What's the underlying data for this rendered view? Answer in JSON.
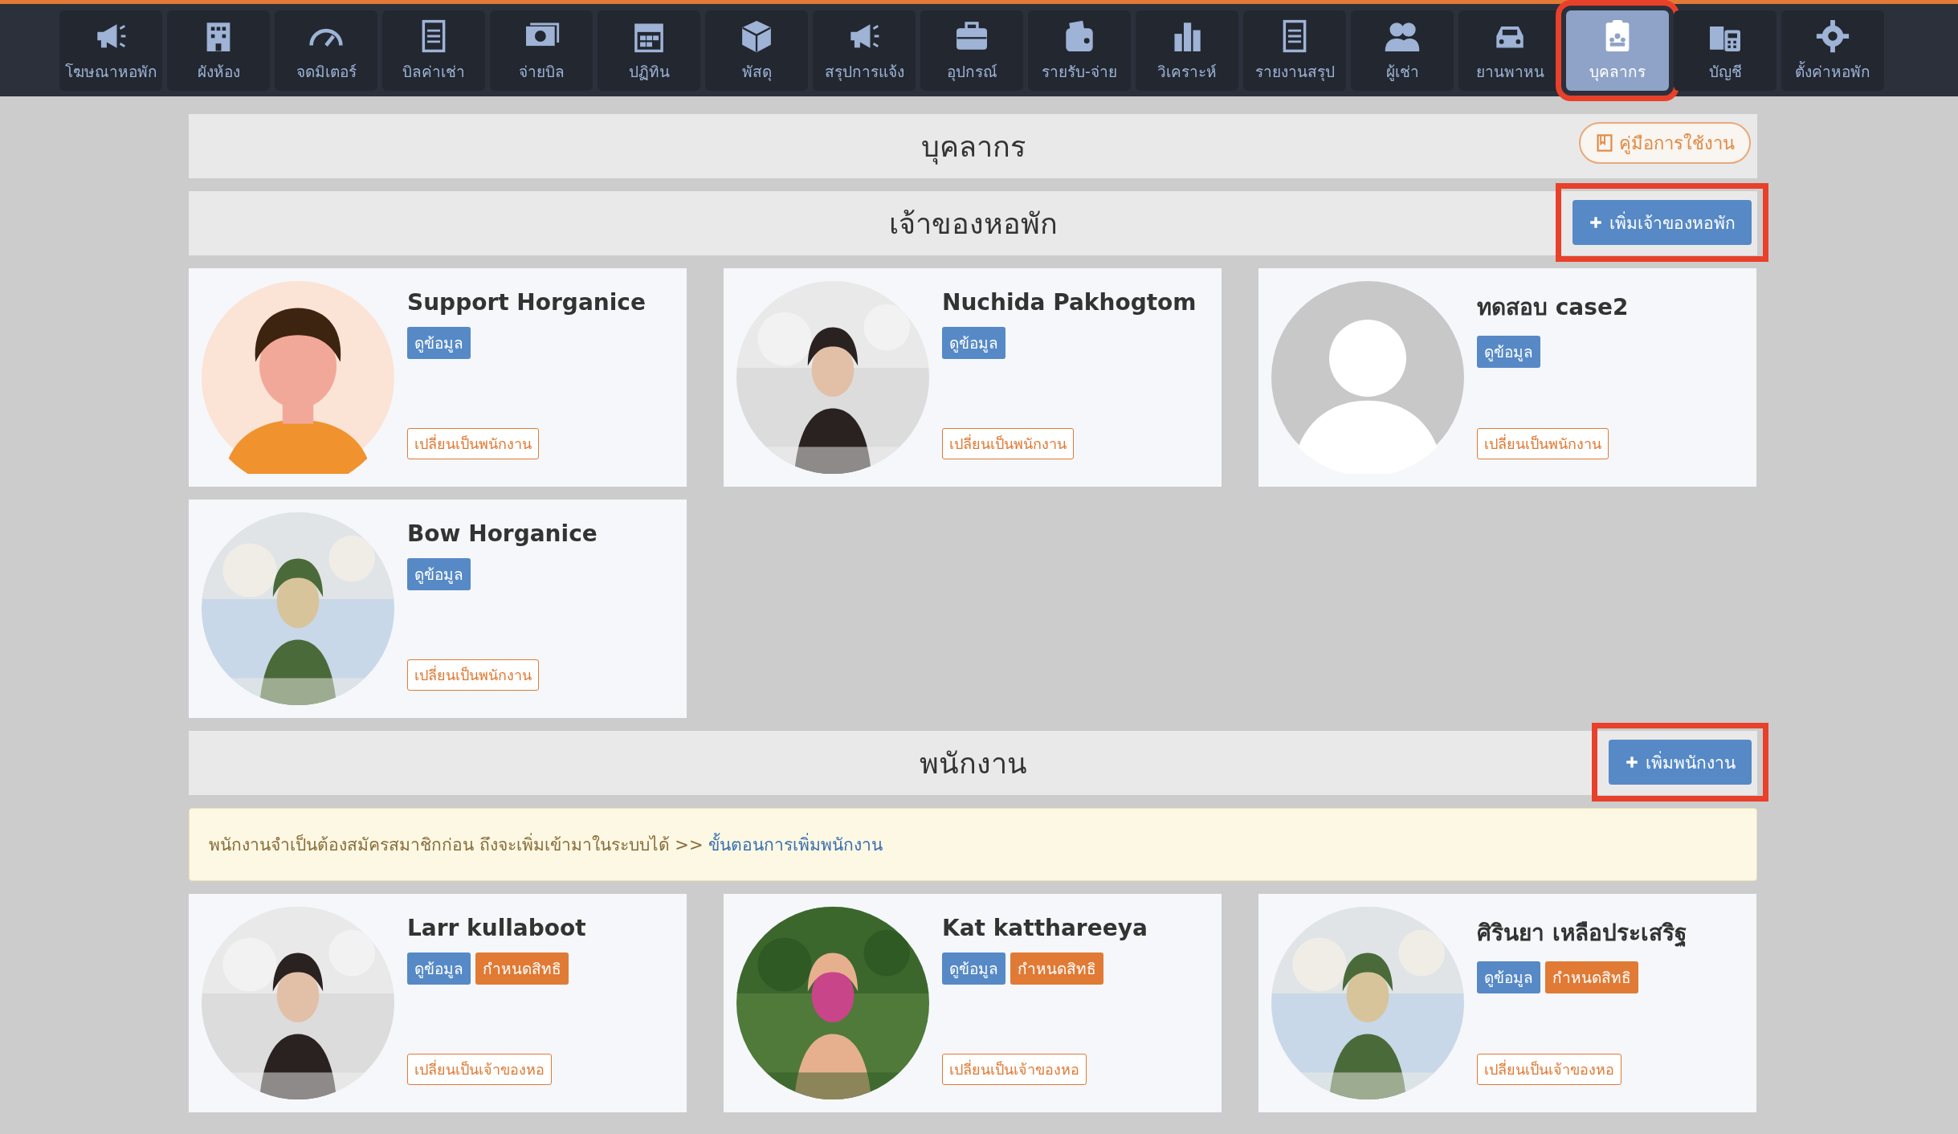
{
  "nav": [
    {
      "label": "โฆษณาหอพัก",
      "selected": false,
      "highlighted": false
    },
    {
      "label": "ผังห้อง",
      "selected": false,
      "highlighted": false
    },
    {
      "label": "จดมิเตอร์",
      "selected": false,
      "highlighted": false
    },
    {
      "label": "บิลค่าเช่า",
      "selected": false,
      "highlighted": false
    },
    {
      "label": "จ่ายบิล",
      "selected": false,
      "highlighted": false
    },
    {
      "label": "ปฏิทิน",
      "selected": false,
      "highlighted": false
    },
    {
      "label": "พัสดุ",
      "selected": false,
      "highlighted": false
    },
    {
      "label": "สรุปการแจ้ง",
      "selected": false,
      "highlighted": false
    },
    {
      "label": "อุปกรณ์",
      "selected": false,
      "highlighted": false
    },
    {
      "label": "รายรับ-จ่าย",
      "selected": false,
      "highlighted": false
    },
    {
      "label": "วิเคราะห์",
      "selected": false,
      "highlighted": false
    },
    {
      "label": "รายงานสรุป",
      "selected": false,
      "highlighted": false
    },
    {
      "label": "ผู้เช่า",
      "selected": false,
      "highlighted": false
    },
    {
      "label": "ยานพาหน",
      "selected": false,
      "highlighted": false
    },
    {
      "label": "บุคลากร",
      "selected": true,
      "highlighted": true
    },
    {
      "label": "บัญชี",
      "selected": false,
      "highlighted": false
    },
    {
      "label": "ตั้งค่าหอพัก",
      "selected": false,
      "highlighted": false
    }
  ],
  "page_title": "บุคลากร",
  "manual_button": "คู่มือการใช้งาน",
  "owners": {
    "title": "เจ้าของหอพัก",
    "add_button": {
      "label": "เพิ่มเจ้าของหอพัก",
      "highlighted": true
    },
    "cards": [
      {
        "name": "Support Horganice",
        "kind": "illustration",
        "tags": [
          {
            "label": "ดูข้อมูล",
            "kind": "info"
          }
        ],
        "switch_label": "เปลี่ยนเป็นพนักงาน"
      },
      {
        "name": "Nuchida Pakhogtom",
        "kind": "picture",
        "tags": [
          {
            "label": "ดูข้อมูล",
            "kind": "info"
          }
        ],
        "switch_label": "เปลี่ยนเป็นพนักงาน"
      },
      {
        "name": "ทดสอบ case2",
        "kind": "placeholder",
        "tags": [
          {
            "label": "ดูข้อมูล",
            "kind": "info"
          }
        ],
        "switch_label": "เปลี่ยนเป็นพนักงาน"
      },
      {
        "name": "Bow Horganice",
        "kind": "picture",
        "tags": [
          {
            "label": "ดูข้อมูล",
            "kind": "info"
          }
        ],
        "switch_label": "เปลี่ยนเป็นพนักงาน"
      }
    ]
  },
  "staff": {
    "title": "พนักงาน",
    "add_button": {
      "label": "เพิ่มพนักงาน",
      "highlighted": true
    },
    "notice": "พนักงานจำเป็นต้องสมัครสมาชิกก่อน ถึงจะเพิ่มเข้ามาในระบบได้ >>",
    "notice_link": "ขั้นตอนการเพิ่มพนักงาน",
    "cards": [
      {
        "name": "Larr kullaboot",
        "kind": "picture",
        "tags": [
          {
            "label": "ดูข้อมูล",
            "kind": "info"
          },
          {
            "label": "กำหนดสิทธิ",
            "kind": "perm"
          }
        ],
        "switch_label": "เปลี่ยนเป็นเจ้าของหอ"
      },
      {
        "name": "Kat katthareeya",
        "kind": "picture",
        "tags": [
          {
            "label": "ดูข้อมูล",
            "kind": "info"
          },
          {
            "label": "กำหนดสิทธิ",
            "kind": "perm"
          }
        ],
        "switch_label": "เปลี่ยนเป็นเจ้าของหอ"
      },
      {
        "name": "ศิรินยา เหลือประเสริฐ",
        "kind": "picture",
        "tags": [
          {
            "label": "ดูข้อมูล",
            "kind": "info"
          },
          {
            "label": "กำหนดสิทธิ",
            "kind": "perm"
          }
        ],
        "switch_label": "เปลี่ยนเป็นเจ้าของหอ"
      }
    ]
  }
}
